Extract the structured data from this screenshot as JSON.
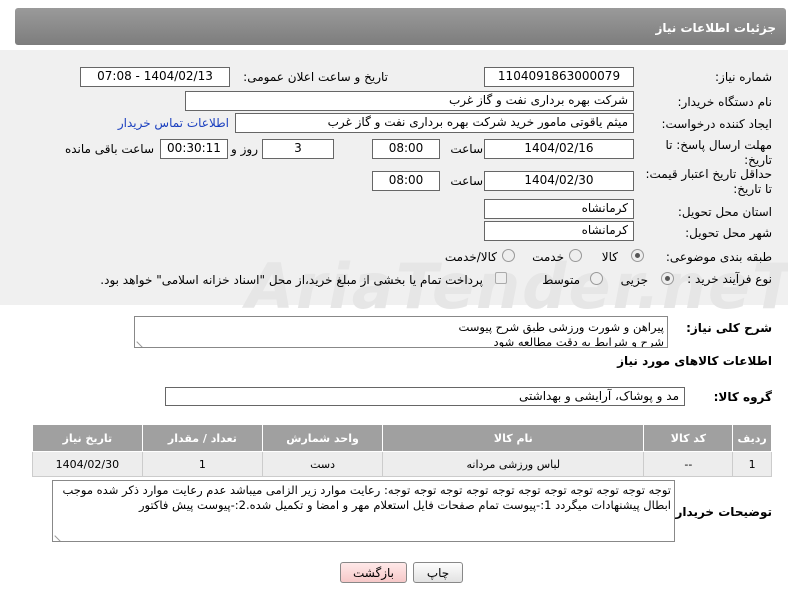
{
  "header": {
    "title": "جزئیات اطلاعات نیاز"
  },
  "form": {
    "need_number_label": "شماره نیاز:",
    "need_number": "1104091863000079",
    "announce_label": "تاریخ و ساعت اعلان عمومی:",
    "announce_value": "1404/02/13 - 07:08",
    "buyer_org_label": "نام دستگاه خریدار:",
    "buyer_org": "شرکت بهره برداری نفت و گاز غرب",
    "creator_label": "ایجاد کننده درخواست:",
    "creator": "میثم یاقوتی مامور خرید شرکت بهره برداری نفت و گاز غرب",
    "contact_link": "اطلاعات تماس خریدار",
    "reply_deadline_label_1": "مهلت ارسال پاسخ: تا",
    "reply_deadline_label_2": "تاریخ:",
    "reply_date": "1404/02/16",
    "time_label": "ساعت",
    "reply_time": "08:00",
    "days_value": "3",
    "days_label": "روز و",
    "remaining_time": "00:30:11",
    "remaining_label": "ساعت باقی مانده",
    "price_validity_label_1": "حداقل تاریخ اعتبار قیمت:",
    "price_validity_label_2": "تا تاریخ:",
    "price_date": "1404/02/30",
    "price_time": "08:00",
    "province_label": "استان محل تحویل:",
    "province": "کرمانشاه",
    "city_label": "شهر محل تحویل:",
    "city": "کرمانشاه",
    "category_label": "طبقه بندی موضوعی:",
    "category_options": [
      "کالا",
      "خدمت",
      "کالا/خدمت"
    ],
    "process_label": "نوع فرآیند خرید :",
    "process_options": [
      "جزیی",
      "متوسط"
    ],
    "payment_note": "پرداخت تمام یا بخشی از مبلغ خرید،از محل \"اسناد خزانه اسلامی\" خواهد بود."
  },
  "watermark": {
    "text": "AriaTender.neT"
  },
  "description": {
    "label": "شرح کلی نیاز:",
    "lines": [
      "پیراهن و شورت ورزشی طبق شرح پیوست",
      "شرح و شرایط به دقت مطالعه شود"
    ]
  },
  "goods_section": {
    "title": "اطلاعات کالاهای مورد نیاز",
    "group_label": "گروه کالا:",
    "group_value": "مد و پوشاک، آرایشی و بهداشتی"
  },
  "table": {
    "headers": [
      "ردیف",
      "کد کالا",
      "نام کالا",
      "واحد شمارش",
      "تعداد / مقدار",
      "تاریخ نیاز"
    ],
    "rows": [
      [
        "1",
        "--",
        "لباس ورزشی مردانه",
        "دست",
        "1",
        "1404/02/30"
      ]
    ]
  },
  "buyer_notes": {
    "label": "توضیحات خریدار:",
    "text": "توجه توجه توجه توجه توجه توجه توجه توجه توجه توجه توجه: رعایت موارد زیر الزامی میباشد عدم رعایت موارد ذکر شده موجب ابطال پیشنهادات میگردد 1:-پیوست تمام صفحات  فایل استعلام مهر و امضا و تکمیل شده.2:-پیوست پیش فاکتور"
  },
  "buttons": {
    "print": "چاپ",
    "back": "بازگشت"
  }
}
